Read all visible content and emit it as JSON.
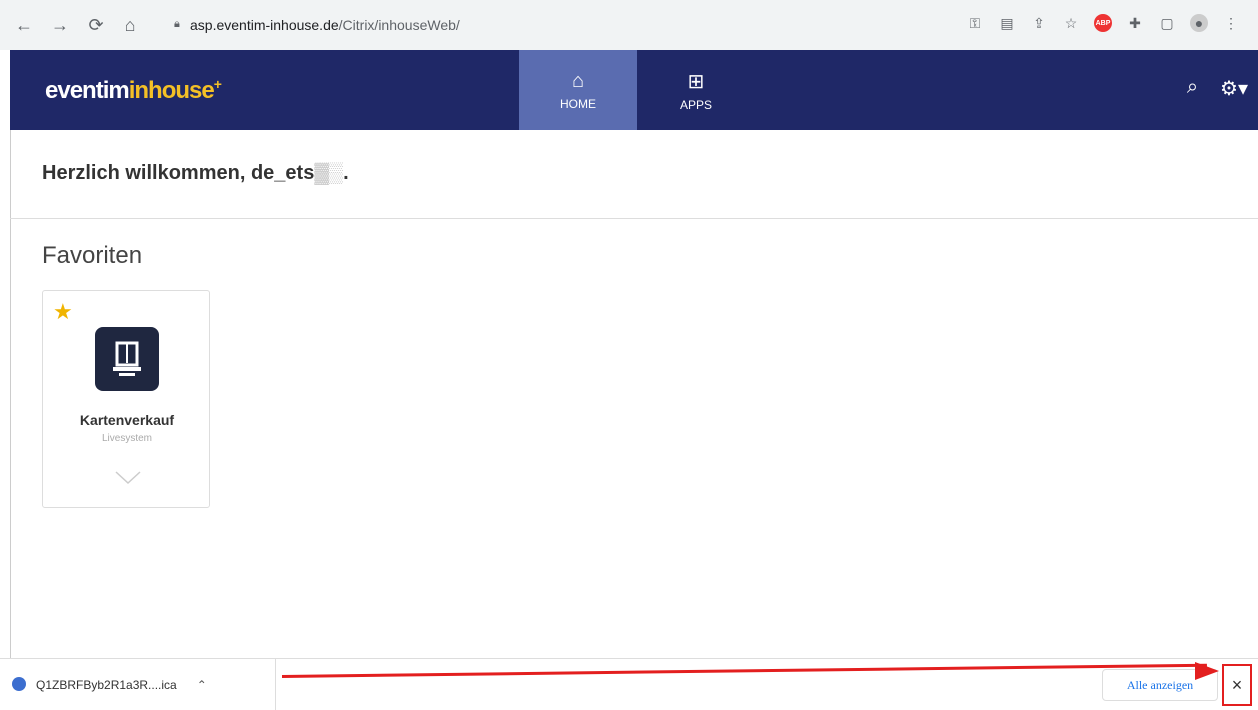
{
  "browser": {
    "url_host": "asp.eventim-inhouse.de",
    "url_path": "/Citrix/inhouseWeb/"
  },
  "header": {
    "logo_part1": "eventim",
    "logo_part2": "inhouse",
    "logo_star": "+",
    "tabs": [
      {
        "label": "HOME",
        "icon": "home-icon"
      },
      {
        "label": "APPS",
        "icon": "grid-icon"
      }
    ]
  },
  "welcome_text": "Herzlich willkommen, de_ets",
  "section_title": "Favoriten",
  "app": {
    "name": "Kartenverkauf",
    "sub": "Livesystem"
  },
  "download": {
    "file": "Q1ZBRFByb2R1a3R....ica",
    "show_all": "Alle anzeigen",
    "close": "×"
  }
}
